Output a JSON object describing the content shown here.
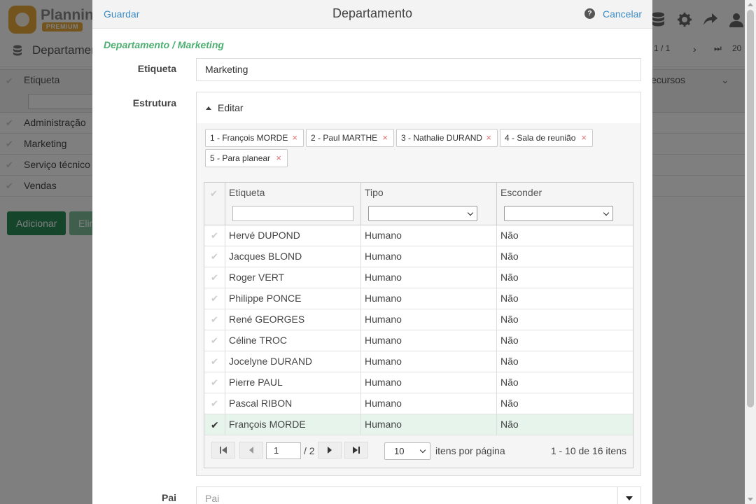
{
  "background": {
    "brand": {
      "name": "Planning",
      "badge": "PREMIUM"
    },
    "title": "Departamento",
    "pager": {
      "page": "1 / 1",
      "size": "20"
    },
    "table": {
      "label_col": "Etiqueta",
      "right_col": "ecursos",
      "rows": [
        "Administração",
        "Marketing",
        "Serviço técnico",
        "Vendas"
      ]
    },
    "buttons": {
      "add": "Adicionar",
      "delete": "Elim"
    },
    "icons": [
      "database-icon",
      "gear-icon",
      "share-icon",
      "user-icon"
    ],
    "colors": {
      "brand": "#e8a83a",
      "add": "#2b8a57",
      "delete": "#7fbf98"
    }
  },
  "modal": {
    "save": "Guardar",
    "title": "Departamento",
    "cancel": "Cancelar",
    "breadcrumb": "Departamento / Marketing",
    "fields": {
      "label": {
        "name": "Etiqueta",
        "value": "Marketing"
      },
      "structure": {
        "name": "Estrutura",
        "toggle": "Editar"
      },
      "parent": {
        "name": "Pai",
        "placeholder": "Pai"
      }
    },
    "tags": [
      "1 - François MORDE",
      "2 - Paul MARTHE",
      "3 - Nathalie DURAND",
      "4 - Sala de reunião",
      "5 - Para planear"
    ],
    "grid": {
      "columns": [
        "Etiqueta",
        "Tipo",
        "Esconder"
      ],
      "rows": [
        {
          "label": "Hervé DUPOND",
          "type": "Humano",
          "hide": "Não",
          "selected": false
        },
        {
          "label": "Jacques BLOND",
          "type": "Humano",
          "hide": "Não",
          "selected": false
        },
        {
          "label": "Roger VERT",
          "type": "Humano",
          "hide": "Não",
          "selected": false
        },
        {
          "label": "Philippe PONCE",
          "type": "Humano",
          "hide": "Não",
          "selected": false
        },
        {
          "label": "René GEORGES",
          "type": "Humano",
          "hide": "Não",
          "selected": false
        },
        {
          "label": "Céline TROC",
          "type": "Humano",
          "hide": "Não",
          "selected": false
        },
        {
          "label": "Jocelyne DURAND",
          "type": "Humano",
          "hide": "Não",
          "selected": false
        },
        {
          "label": "Pierre PAUL",
          "type": "Humano",
          "hide": "Não",
          "selected": false
        },
        {
          "label": "Pascal RIBON",
          "type": "Humano",
          "hide": "Não",
          "selected": false
        },
        {
          "label": "François MORDE",
          "type": "Humano",
          "hide": "Não",
          "selected": true
        }
      ],
      "pager": {
        "page": "1",
        "of": "/ 2",
        "page_size": "10",
        "per_page_text": "itens por página",
        "info": "1 - 10 de 16 itens"
      }
    },
    "colors": {
      "link": "#3d8cc4",
      "breadcrumb": "#4caf72",
      "selected_row": "#e7f4ec"
    }
  }
}
